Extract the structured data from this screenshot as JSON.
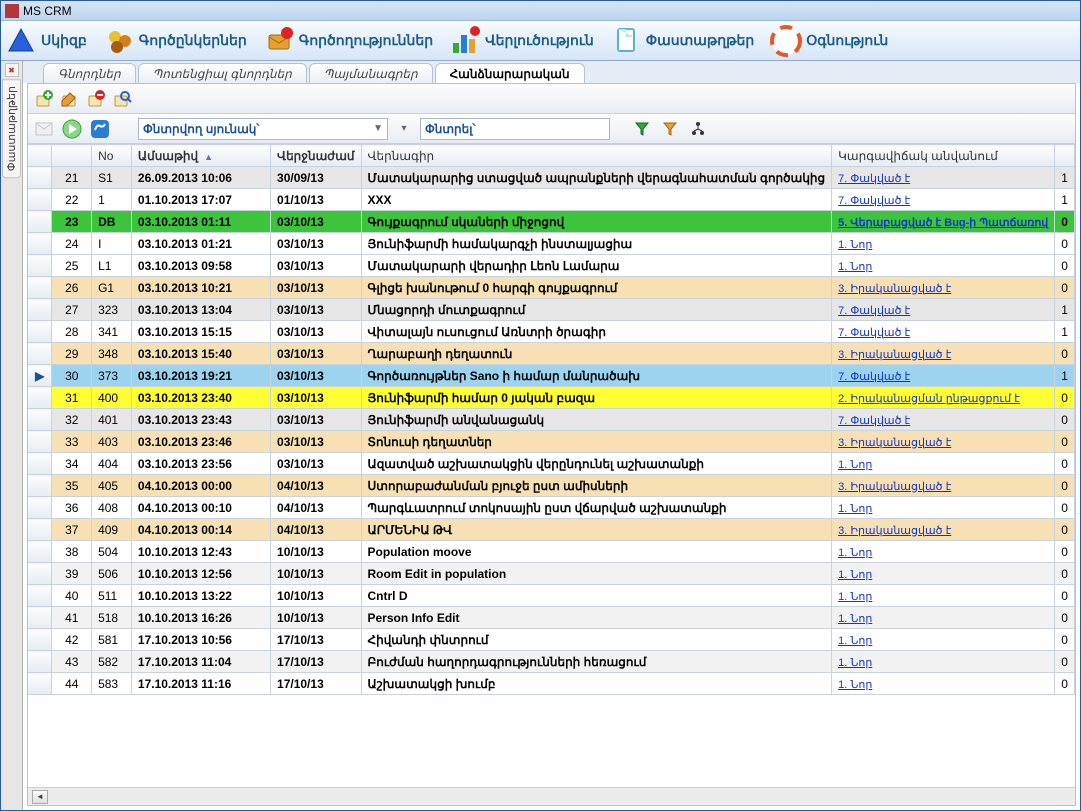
{
  "title": "MS CRM",
  "mainToolbar": [
    {
      "id": "home",
      "label": "Սկիզբ",
      "color": "#2a5fdc"
    },
    {
      "id": "partners",
      "label": "Գործընկերներ",
      "color": "#a88b1e"
    },
    {
      "id": "processes",
      "label": "Գործողություններ",
      "color": "#c02a2a"
    },
    {
      "id": "analytics",
      "label": "Վերլուծություն",
      "color": "#2a8bd6"
    },
    {
      "id": "documents",
      "label": "Փաստաթղթեր",
      "color": "#2aaed6"
    },
    {
      "id": "help",
      "label": "Օգնություն",
      "color": "#e25a2a"
    }
  ],
  "sideTabLabel": "Փաստաթղթեր",
  "tabs": [
    {
      "id": "buyers",
      "label": "Գնորդներ",
      "active": false
    },
    {
      "id": "potential",
      "label": "Պոտենցիալ գնորդներ",
      "active": false
    },
    {
      "id": "contracts",
      "label": "Պայմանագրեր",
      "active": false
    },
    {
      "id": "tasks",
      "label": "Հանձնարարական",
      "active": true
    }
  ],
  "filterBar": {
    "col1Label": "Փնտրվող սյունակ՝",
    "col2Label": "Փնտրել՝"
  },
  "columns": {
    "no": "No",
    "date": "Ամսաթիվ",
    "enddate": "Վերջնաժամ",
    "subject": "Վերնագիր",
    "status": "Կարգավիճակ անվանում"
  },
  "rows": [
    {
      "n": "21",
      "flag": "S1",
      "date": "26.09.2013 10:06",
      "end": "30/09/13",
      "subj": "Մատակարարից ստացված ապրանքների վերագնահատման գործակից",
      "stat": "7. Փակված է",
      "last": "1",
      "cls": "row-grey"
    },
    {
      "n": "22",
      "flag": "1",
      "date": "01.10.2013 17:07",
      "end": "01/10/13",
      "subj": "XXX",
      "stat": "7. Փակված է",
      "last": "1",
      "cls": "row-even"
    },
    {
      "n": "23",
      "flag": "DB",
      "date": "03.10.2013 01:11",
      "end": "03/10/13",
      "subj": "Գույքագրում սկաների միջոցով",
      "stat": "5. Վերաբացված է Bug-ի Պատճառով",
      "last": "0",
      "cls": "row-green"
    },
    {
      "n": "24",
      "flag": "I",
      "date": "03.10.2013 01:21",
      "end": "03/10/13",
      "subj": "Յունիֆարմի համակարգչի ինստալյացիա",
      "stat": "1. Նոր",
      "last": "0",
      "cls": "row-even"
    },
    {
      "n": "25",
      "flag": "L1",
      "date": "03.10.2013 09:58",
      "end": "03/10/13",
      "subj": "Մատակարարի վերադիր Լեոն Լամարա",
      "stat": "1. Նոր",
      "last": "0",
      "cls": "row-even"
    },
    {
      "n": "26",
      "flag": "G1",
      "date": "03.10.2013 10:21",
      "end": "03/10/13",
      "subj": "Գլիցե խանութում 0 հարգի գույքագրում",
      "stat": "3. Իրականացված է",
      "last": "0",
      "cls": "row-tan"
    },
    {
      "n": "27",
      "flag": "323",
      "date": "03.10.2013 13:04",
      "end": "03/10/13",
      "subj": "Մնացորդի մուտքագրում",
      "stat": "7. Փակված է",
      "last": "1",
      "cls": "row-grey"
    },
    {
      "n": "28",
      "flag": "341",
      "date": "03.10.2013 15:15",
      "end": "03/10/13",
      "subj": "Վիտալայն ուսուցում Առնտրի ծրագիր",
      "stat": "7. Փակված է",
      "last": "1",
      "cls": "row-even"
    },
    {
      "n": "29",
      "flag": "348",
      "date": "03.10.2013 15:40",
      "end": "03/10/13",
      "subj": "Ղարաբաղի դեղատուն",
      "stat": "3. Իրականացված է",
      "last": "0",
      "cls": "row-tan"
    },
    {
      "n": "30",
      "flag": "373",
      "date": "03.10.2013 19:21",
      "end": "03/10/13",
      "subj": "Գործառույթներ Sano ի համար մանրածախ",
      "stat": "7. Փակված է",
      "last": "1",
      "cls": "row-blue",
      "sel": true
    },
    {
      "n": "31",
      "flag": "400",
      "date": "03.10.2013 23:40",
      "end": "03/10/13",
      "subj": "Յունիֆարմի համար 0 յական բազա",
      "stat": "2. Իրականացման ընթացքում է",
      "last": "0",
      "cls": "row-yellow"
    },
    {
      "n": "32",
      "flag": "401",
      "date": "03.10.2013 23:43",
      "end": "03/10/13",
      "subj": "Յունիֆարմի անվանացանկ",
      "stat": "7. Փակված է",
      "last": "0",
      "cls": "row-grey"
    },
    {
      "n": "33",
      "flag": "403",
      "date": "03.10.2013 23:46",
      "end": "03/10/13",
      "subj": "Տոնուսի դեղատներ",
      "stat": "3. Իրականացված է",
      "last": "0",
      "cls": "row-tan"
    },
    {
      "n": "34",
      "flag": "404",
      "date": "03.10.2013 23:56",
      "end": "03/10/13",
      "subj": "Ազատված աշխատակցին վերընդունել աշխատանքի",
      "stat": "1. Նոր",
      "last": "0",
      "cls": "row-even"
    },
    {
      "n": "35",
      "flag": "405",
      "date": "04.10.2013 00:00",
      "end": "04/10/13",
      "subj": "Ստորաբաժանման բյուջե ըստ ամիսների",
      "stat": "3. Իրականացված է",
      "last": "0",
      "cls": "row-tan"
    },
    {
      "n": "36",
      "flag": "408",
      "date": "04.10.2013 00:10",
      "end": "04/10/13",
      "subj": "Պարգևատրում տոկոսային ըստ վճարված աշխատանքի",
      "stat": "1. Նոր",
      "last": "0",
      "cls": "row-even"
    },
    {
      "n": "37",
      "flag": "409",
      "date": "04.10.2013 00:14",
      "end": "04/10/13",
      "subj": "ԱՐՄԵՆԻԱ ԹՎ",
      "stat": "3. Իրականացված է",
      "last": "0",
      "cls": "row-tan"
    },
    {
      "n": "38",
      "flag": "504",
      "date": "10.10.2013 12:43",
      "end": "10/10/13",
      "subj": "Population moove",
      "stat": "1. Նոր",
      "last": "0",
      "cls": "row-even"
    },
    {
      "n": "39",
      "flag": "506",
      "date": "10.10.2013 12:56",
      "end": "10/10/13",
      "subj": "Room Edit in population",
      "stat": "1. Նոր",
      "last": "0",
      "cls": "row-odd"
    },
    {
      "n": "40",
      "flag": "511",
      "date": "10.10.2013 13:22",
      "end": "10/10/13",
      "subj": "Cntrl D",
      "stat": "1. Նոր",
      "last": "0",
      "cls": "row-even"
    },
    {
      "n": "41",
      "flag": "518",
      "date": "10.10.2013 16:26",
      "end": "10/10/13",
      "subj": "Person Info Edit",
      "stat": "1. Նոր",
      "last": "0",
      "cls": "row-odd"
    },
    {
      "n": "42",
      "flag": "581",
      "date": "17.10.2013 10:56",
      "end": "17/10/13",
      "subj": "Հիվանդի փնտրում",
      "stat": "1. Նոր",
      "last": "0",
      "cls": "row-even"
    },
    {
      "n": "43",
      "flag": "582",
      "date": "17.10.2013 11:04",
      "end": "17/10/13",
      "subj": "Բուժման հաղորդագրությունների հեռացում",
      "stat": "1. Նոր",
      "last": "0",
      "cls": "row-odd"
    },
    {
      "n": "44",
      "flag": "583",
      "date": "17.10.2013 11:16",
      "end": "17/10/13",
      "subj": "Աշխատակցի խումբ",
      "stat": "1. Նոր",
      "last": "0",
      "cls": "row-even"
    }
  ]
}
